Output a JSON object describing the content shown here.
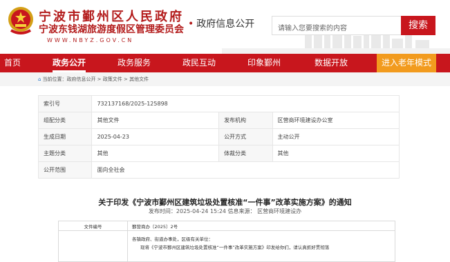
{
  "header": {
    "title_main": "宁波市鄞州区人民政府",
    "title_sub": "宁波东钱湖旅游度假区管理委员会",
    "url": "WWW.NBYZ.GOV.CN",
    "section": "政府信息公开",
    "search_placeholder": "请输入您要搜索的内容",
    "search_button": "搜索"
  },
  "nav": {
    "items": [
      {
        "label": "首页"
      },
      {
        "label": "政务公开"
      },
      {
        "label": "政务服务"
      },
      {
        "label": "政民互动"
      },
      {
        "label": "印象鄞州"
      },
      {
        "label": "数据开放"
      }
    ],
    "elder_mode": "进入老年模式",
    "active_color": "#c8161d",
    "elder_color": "#f29b1e"
  },
  "breadcrumb": {
    "prefix": "当前位置：",
    "path": "政府信息公开 > 政策文件 > 其他文件"
  },
  "meta": {
    "index_label": "索引号",
    "index_value": "732137168/2025-125898",
    "category_label": "组配分类",
    "category_value": "其他文件",
    "publisher_label": "发布机构",
    "publisher_value": "区营商环境建设办公室",
    "date_label": "生成日期",
    "date_value": "2025-04-23",
    "method_label": "公开方式",
    "method_value": "主动公开",
    "topic_label": "主题分类",
    "topic_value": "其他",
    "genre_label": "体裁分类",
    "genre_value": "其他",
    "scope_label": "公开范围",
    "scope_value": "面向全社会"
  },
  "document": {
    "title": "关于印发《宁波市鄞州区建筑垃圾处置核准“一件事”改革实施方案》的通知",
    "info": "发布时间：2025-04-24 15:24 信息来源： 区营商环境建设办",
    "number_label": "文件编号",
    "number_value": "鄞营商办〔2025〕2号",
    "salutation": "各镇政府、街道办事处，区级有关单位：",
    "body": "现将《宁波市鄞州区建筑垃圾处置核准“一件事”改革实施方案》印发给你们，请认真抓好贯彻落"
  }
}
